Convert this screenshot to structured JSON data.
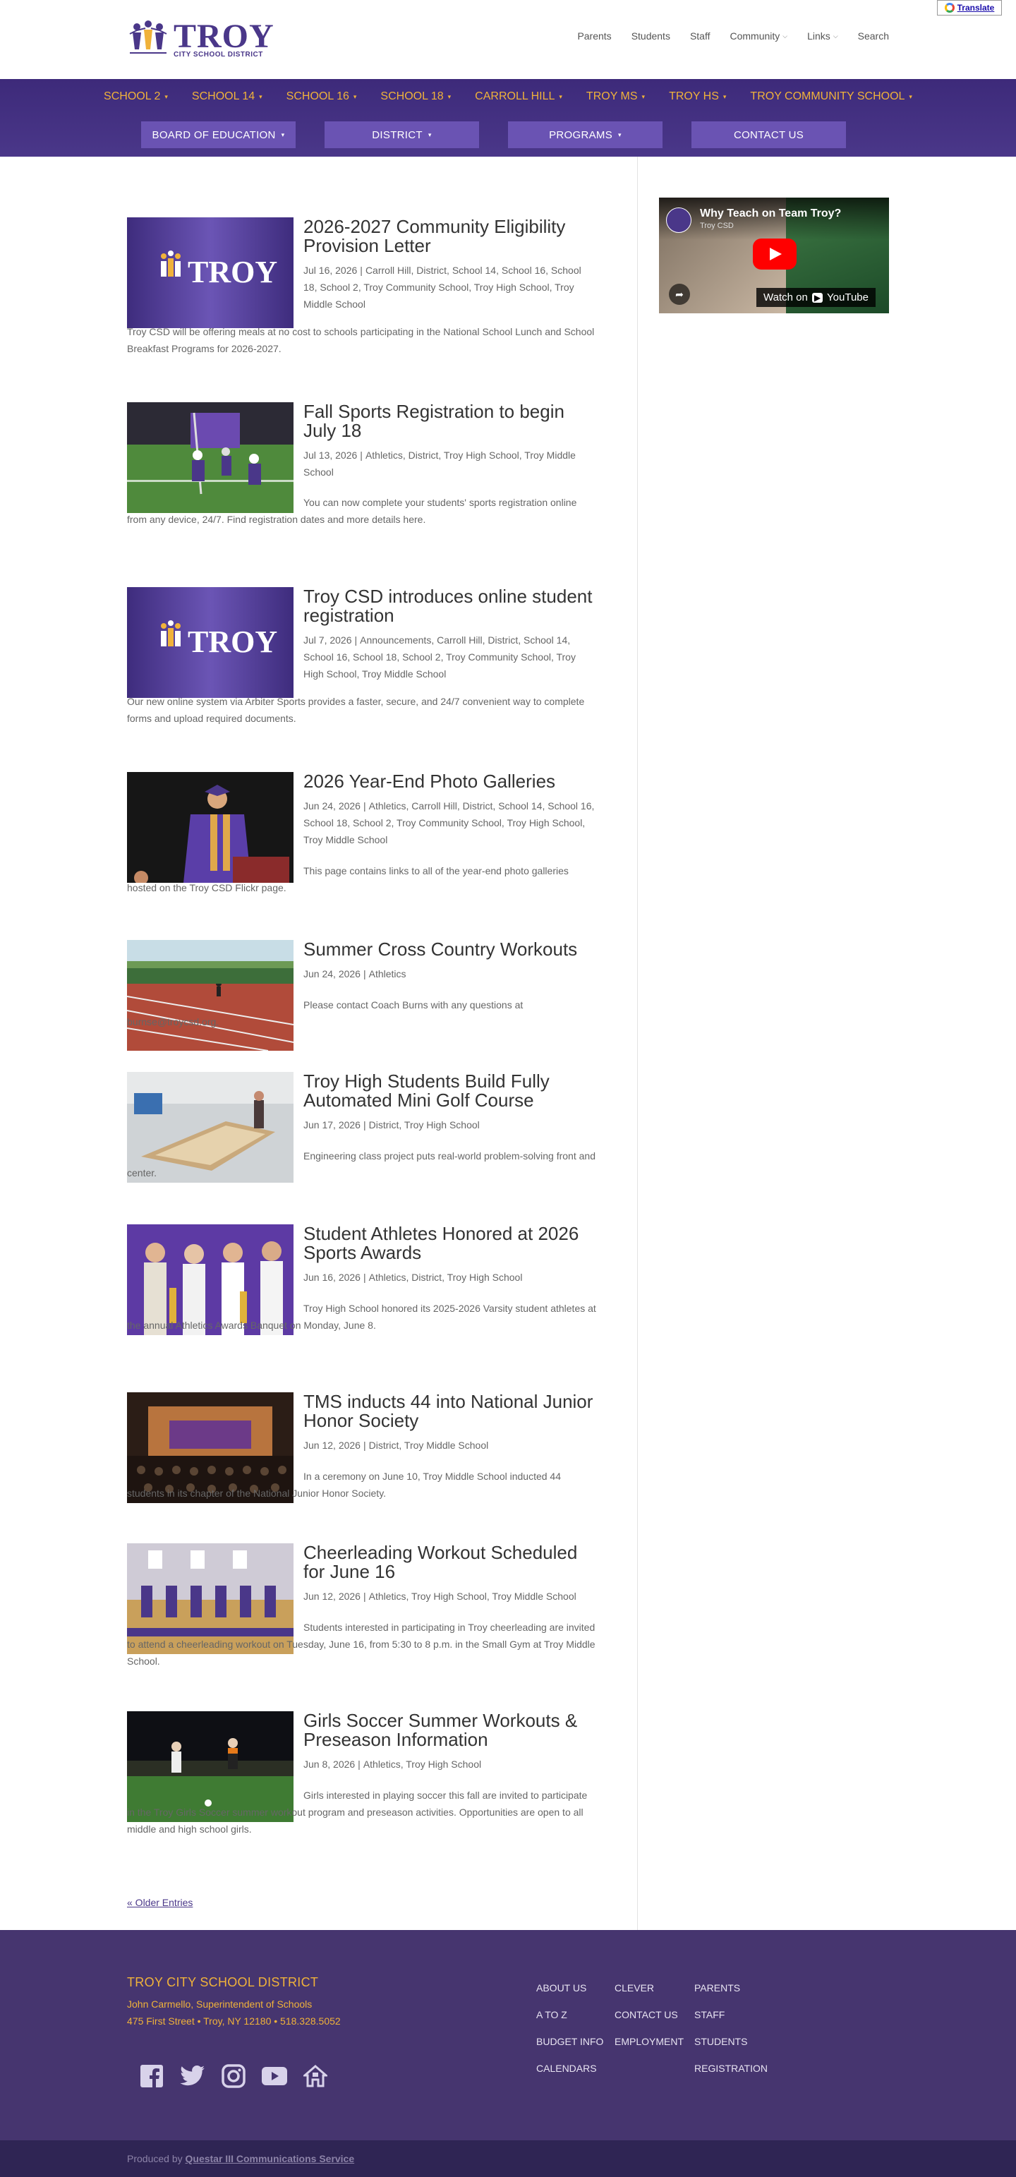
{
  "translate_label": "Translate",
  "logo": {
    "big": "TROY",
    "small": "CITY SCHOOL DISTRICT"
  },
  "topnav": [
    {
      "label": "Parents",
      "dropdown": false
    },
    {
      "label": "Students",
      "dropdown": false
    },
    {
      "label": "Staff",
      "dropdown": false
    },
    {
      "label": "Community",
      "dropdown": true
    },
    {
      "label": "Links",
      "dropdown": true
    },
    {
      "label": "Search",
      "dropdown": false
    }
  ],
  "schoolnav": [
    "SCHOOL 2",
    "SCHOOL 14",
    "SCHOOL 16",
    "SCHOOL 18",
    "CARROLL HILL",
    "TROY MS",
    "TROY HS",
    "TROY COMMUNITY SCHOOL"
  ],
  "buttons": [
    {
      "label": "BOARD OF EDUCATION",
      "dropdown": true
    },
    {
      "label": "DISTRICT",
      "dropdown": true
    },
    {
      "label": "PROGRAMS",
      "dropdown": true
    },
    {
      "label": "CONTACT US",
      "dropdown": false
    }
  ],
  "posts": [
    {
      "title": "2026-2027 Community Eligibility Provision Letter",
      "date": "Jul 16, 2026",
      "tags": "Carroll Hill, District, School 14, School 16, School 18, School 2, Troy Community School, Troy High School, Troy Middle School",
      "excerpt": "Troy CSD will be offering meals at no cost to schools participating in the National School Lunch and School Breakfast Programs for 2026-2027.",
      "image": "troy-logo-purple"
    },
    {
      "title": "Fall Sports Registration to begin July 18",
      "date": "Jul 13, 2026",
      "tags": "Athletics, District, Troy High School, Troy Middle School",
      "excerpt": "You can now complete your students' sports registration online from any device, 24/7. Find registration dates and more details here.",
      "image": "football-flag"
    },
    {
      "title": "Troy CSD introduces online student registration",
      "date": "Jul 7, 2026",
      "tags": "Announcements, Carroll Hill, District, School 14, School 16, School 18, School 2, Troy Community School, Troy High School, Troy Middle School",
      "excerpt": "Our new online system via Arbiter Sports provides a faster, secure, and 24/7 convenient way to complete forms and upload required documents.",
      "image": "troy-logo-purple"
    },
    {
      "title": "2026 Year-End Photo Galleries",
      "date": "Jun 24, 2026",
      "tags": "Athletics, Carroll Hill, District, School 14, School 16, School 18, School 2, Troy Community School, Troy High School, Troy Middle School",
      "excerpt": "This page contains links to all of the year-end photo galleries hosted on the Troy CSD Flickr page.",
      "image": "graduation-speaker"
    },
    {
      "title": "Summer Cross Country Workouts",
      "date": "Jun 24, 2026",
      "tags": "Athletics",
      "excerpt": "Please contact Coach Burns with any questions at burnse@troycsd.org.",
      "image": "running-track"
    },
    {
      "title": "Troy High Students Build Fully Automated Mini Golf Course",
      "date": "Jun 17, 2026",
      "tags": "District, Troy High School",
      "excerpt": "Engineering class project puts real-world problem-solving front and center.",
      "image": "mini-golf-classroom"
    },
    {
      "title": "Student Athletes Honored at 2026 Sports Awards",
      "date": "Jun 16, 2026",
      "tags": "Athletics, District, Troy High School",
      "excerpt": "Troy High School honored its 2025-2026 Varsity student athletes at the annual Athletics Awards Banquet on Monday, June 8.",
      "image": "award-winners"
    },
    {
      "title": "TMS inducts 44 into National Junior Honor Society",
      "date": "Jun 12, 2026",
      "tags": "District, Troy Middle School",
      "excerpt": "In a ceremony on June 10, Troy Middle School inducted 44 students in its chapter of the National Junior Honor Society.",
      "image": "auditorium-ceremony"
    },
    {
      "title": "Cheerleading Workout Scheduled for June 16",
      "date": "Jun 12, 2026",
      "tags": "Athletics, Troy High School, Troy Middle School",
      "excerpt": "Students interested in participating in Troy cheerleading are invited to attend a cheerleading workout on Tuesday, June 16, from 5:30 to 8 p.m. in the Small Gym at Troy Middle School.",
      "image": "cheerleaders"
    },
    {
      "title": "Girls Soccer Summer Workouts & Preseason Information",
      "date": "Jun 8, 2026",
      "tags": "Athletics, Troy High School",
      "excerpt": "Girls interested in playing soccer this fall are invited to participate in the Troy Girls Soccer summer workout program and preseason activities. Opportunities are open to all middle and high school girls.",
      "image": "soccer-night"
    }
  ],
  "older_entries": "« Older Entries",
  "video": {
    "title": "Why Teach on Team Troy?",
    "channel": "Troy CSD",
    "watch": "Watch on",
    "yt": "YouTube"
  },
  "footer": {
    "district": "TROY CITY SCHOOL DISTRICT",
    "superintendent": "John Carmello, Superintendent of Schools",
    "address": "475 First Street • Troy, NY 12180 • 518.328.5052",
    "col1": [
      "ABOUT US",
      "A TO Z",
      "BUDGET INFO",
      "CALENDARS"
    ],
    "col2": [
      "CLEVER",
      "CONTACT US",
      "EMPLOYMENT"
    ],
    "col3": [
      "PARENTS",
      "STAFF",
      "STUDENTS",
      "REGISTRATION"
    ],
    "social": [
      "facebook-icon",
      "twitter-icon",
      "instagram-icon",
      "youtube-icon",
      "home-icon"
    ]
  },
  "produced": {
    "prefix": "Produced by",
    "name": "Questar III Communications Service"
  },
  "colors": {
    "brand_purple": "#4a3789",
    "gold": "#f0b23a",
    "footer": "#46356f"
  }
}
